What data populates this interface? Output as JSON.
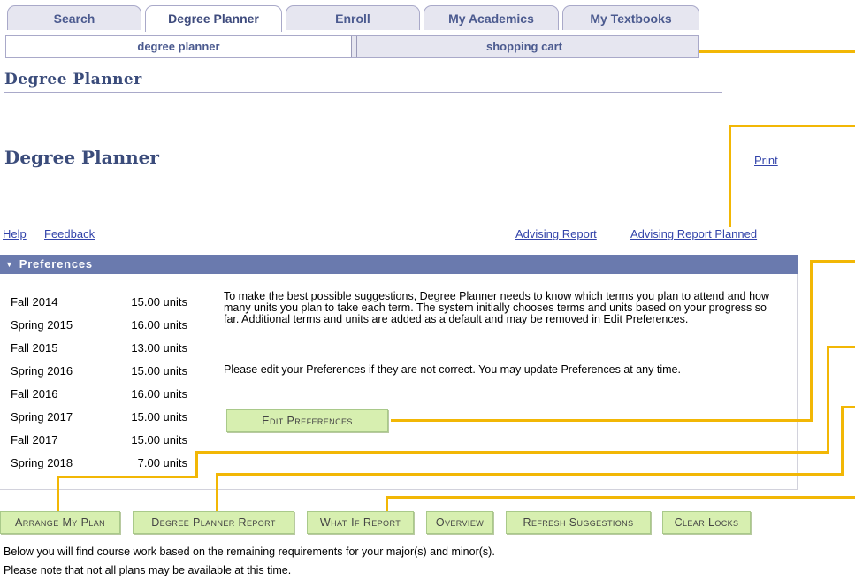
{
  "tabs": [
    {
      "label": "Search",
      "active": false
    },
    {
      "label": "Degree Planner",
      "active": true
    },
    {
      "label": "Enroll",
      "active": false
    },
    {
      "label": "My Academics",
      "active": false
    },
    {
      "label": "My Textbooks",
      "active": false
    }
  ],
  "subtabs": [
    {
      "label": "degree planner",
      "active": true
    },
    {
      "label": "shopping cart",
      "active": false
    }
  ],
  "page": {
    "section_title": "Degree Planner",
    "title": "Degree Planner",
    "print_link": "Print"
  },
  "links": {
    "help": "Help",
    "feedback": "Feedback",
    "advising_report": "Advising Report",
    "advising_report_planned": "Advising Report Planned"
  },
  "preferences": {
    "header": "Preferences",
    "toggle_icon": "triangle-down-icon",
    "terms": [
      {
        "term": "Fall 2014",
        "units": "15.00 units"
      },
      {
        "term": "Spring 2015",
        "units": "16.00 units"
      },
      {
        "term": "Fall 2015",
        "units": "13.00 units"
      },
      {
        "term": "Spring 2016",
        "units": "15.00 units"
      },
      {
        "term": "Fall 2016",
        "units": "16.00 units"
      },
      {
        "term": "Spring 2017",
        "units": "15.00 units"
      },
      {
        "term": "Fall 2017",
        "units": "15.00 units"
      },
      {
        "term": "Spring 2018",
        "units": "7.00 units"
      }
    ],
    "description": "To make the best possible suggestions, Degree Planner needs to know which terms you plan to attend and how many units you plan to take each term. The system initially chooses terms and units based on your progress so far. Additional terms and units are added as a default and may be removed in Edit Preferences.",
    "note": "Please edit your Preferences if they are not correct. You may update Preferences at any time.",
    "edit_button": "Edit Preferences"
  },
  "actions": {
    "arrange": "Arrange My Plan",
    "report": "Degree Planner Report",
    "whatif": "What-If Report",
    "overview": "Overview",
    "refresh": "Refresh Suggestions",
    "clear": "Clear Locks"
  },
  "footer": {
    "line1": "Below you will find course work based on the remaining requirements for your major(s) and minor(s).",
    "line2": "Please note that not all plans may be available at this time."
  },
  "colors": {
    "callout": "#f2b705",
    "prefs_bar": "#6a7aae",
    "button_bg": "#d7efb0"
  }
}
